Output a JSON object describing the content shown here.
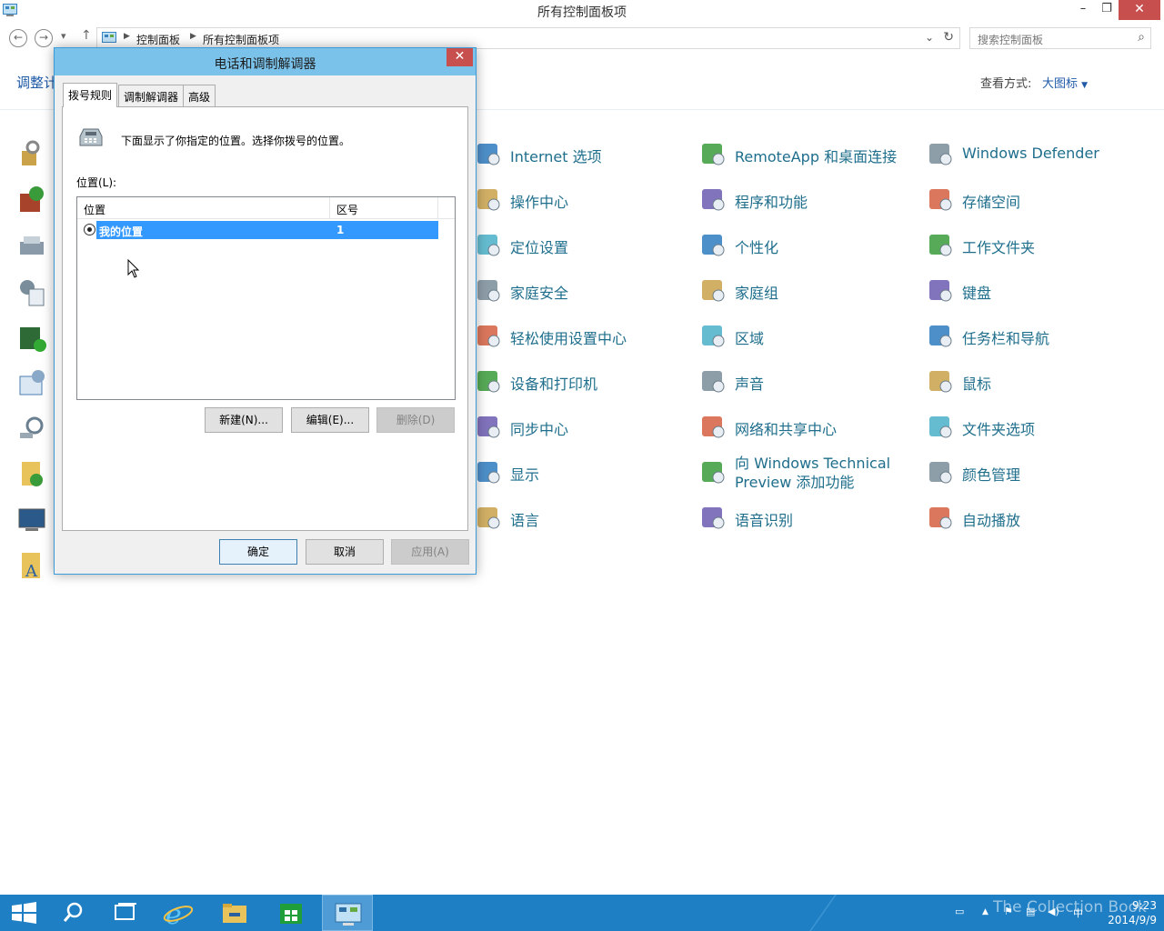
{
  "window": {
    "title": "所有控制面板项",
    "minimize_icon": "minimize-icon",
    "restore_icon": "restore-icon",
    "close_icon": "close-icon"
  },
  "nav": {
    "back_icon": "back-arrow-icon",
    "forward_icon": "forward-arrow-icon",
    "up_icon": "up-arrow-icon",
    "breadcrumbs": [
      "控制面板",
      "所有控制面板项"
    ],
    "search_placeholder": "搜索控制面板"
  },
  "header": {
    "page_title": "调整计",
    "view_by_label": "查看方式:",
    "view_by_value": "大图标"
  },
  "cp_items": [
    {
      "label": "Internet 选项",
      "icon": "internet-options-icon"
    },
    {
      "label": "RemoteApp 和桌面连接",
      "icon": "remoteapp-icon"
    },
    {
      "label": "Windows Defender",
      "icon": "windows-defender-icon"
    },
    {
      "label": "操作中心",
      "icon": "action-center-flag-icon"
    },
    {
      "label": "程序和功能",
      "icon": "programs-features-icon"
    },
    {
      "label": "存储空间",
      "icon": "storage-spaces-icon"
    },
    {
      "label": "定位设置",
      "icon": "location-settings-icon"
    },
    {
      "label": "个性化",
      "icon": "personalization-icon"
    },
    {
      "label": "工作文件夹",
      "icon": "work-folders-icon"
    },
    {
      "label": "家庭安全",
      "icon": "family-safety-icon"
    },
    {
      "label": "家庭组",
      "icon": "homegroup-icon"
    },
    {
      "label": "键盘",
      "icon": "keyboard-icon"
    },
    {
      "label": "轻松使用设置中心",
      "icon": "ease-of-access-icon"
    },
    {
      "label": "区域",
      "icon": "region-globe-icon"
    },
    {
      "label": "任务栏和导航",
      "icon": "taskbar-navigation-icon"
    },
    {
      "label": "设备和打印机",
      "icon": "devices-printers-icon"
    },
    {
      "label": "声音",
      "icon": "sound-speaker-icon"
    },
    {
      "label": "鼠标",
      "icon": "mouse-icon"
    },
    {
      "label": "同步中心",
      "icon": "sync-center-icon"
    },
    {
      "label": "网络和共享中心",
      "icon": "network-sharing-icon"
    },
    {
      "label": "文件夹选项",
      "icon": "folder-options-icon"
    },
    {
      "label": "显示",
      "icon": "display-icon"
    },
    {
      "label": "向 Windows Technical Preview 添加功能",
      "icon": "add-features-icon"
    },
    {
      "label": "颜色管理",
      "icon": "color-management-icon"
    },
    {
      "label": "语言",
      "icon": "language-icon"
    },
    {
      "label": "语音识别",
      "icon": "speech-recognition-icon"
    },
    {
      "label": "自动播放",
      "icon": "autoplay-icon"
    }
  ],
  "dialog": {
    "title": "电话和调制解调器",
    "close_icon": "close-icon",
    "tabs": [
      "拨号规则",
      "调制解调器",
      "高级"
    ],
    "active_tab": "拨号规则",
    "description": "下面显示了你指定的位置。选择你拨号的位置。",
    "locations_label": "位置(L):",
    "columns": [
      "位置",
      "区号"
    ],
    "rows": [
      {
        "location": "我的位置",
        "area_code": "1",
        "selected": true
      }
    ],
    "buttons": {
      "new": "新建(N)...",
      "edit": "编辑(E)...",
      "delete": "删除(D)",
      "ok": "确定",
      "cancel": "取消",
      "apply": "应用(A)"
    }
  },
  "taskbar": {
    "items": [
      "start-icon",
      "search-icon",
      "task-view-icon",
      "internet-explorer-icon",
      "file-explorer-icon",
      "store-icon",
      "control-panel-icon"
    ],
    "active": "control-panel-icon",
    "watermark": "The Collection Book",
    "time": "9:23",
    "date": "2014/9/9"
  },
  "colors": {
    "accent": "#3399ff",
    "dialog_title": "#7bc2ea",
    "close_red": "#c7504f",
    "link_blue": "#1e5aa8",
    "item_label": "#1e6e8c",
    "taskbar": "#1e7fc4"
  }
}
